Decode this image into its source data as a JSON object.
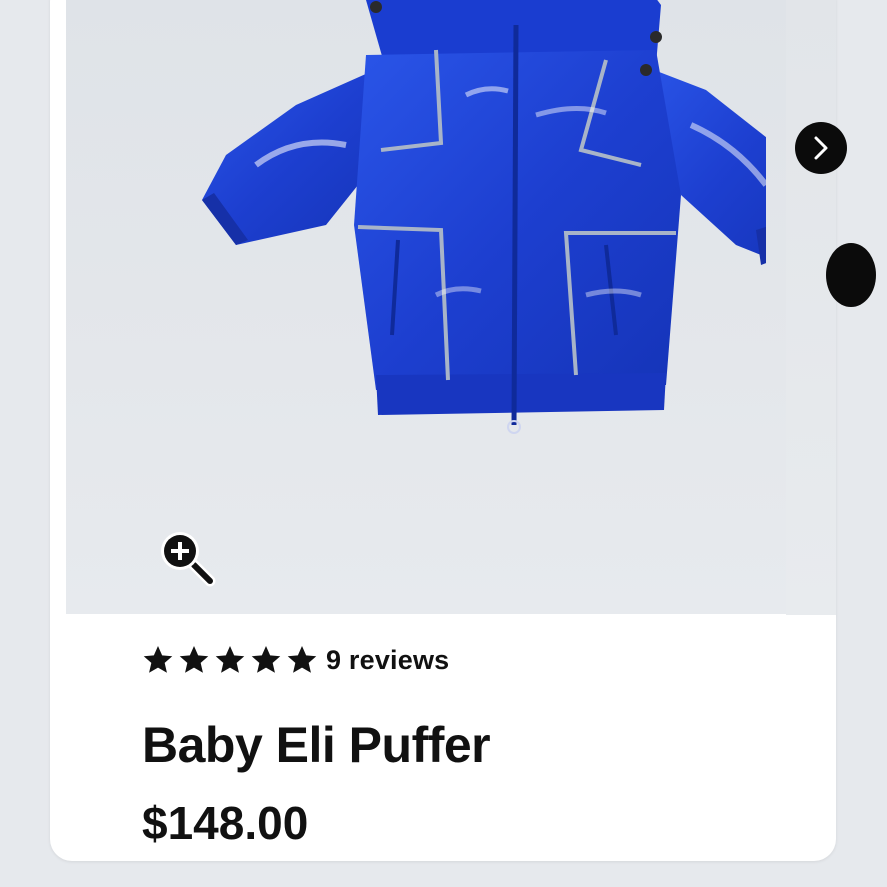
{
  "product": {
    "name": "Baby Eli Puffer",
    "price": "$148.00",
    "rating": 5,
    "reviews_label": "9 reviews",
    "image_subject": "blue glossy hooded baby puffer jacket",
    "accent_color": "#1f44d6"
  },
  "gallery": {
    "zoom_icon": "zoom-in-magnifier-icon",
    "next_icon": "chevron-right-icon"
  }
}
